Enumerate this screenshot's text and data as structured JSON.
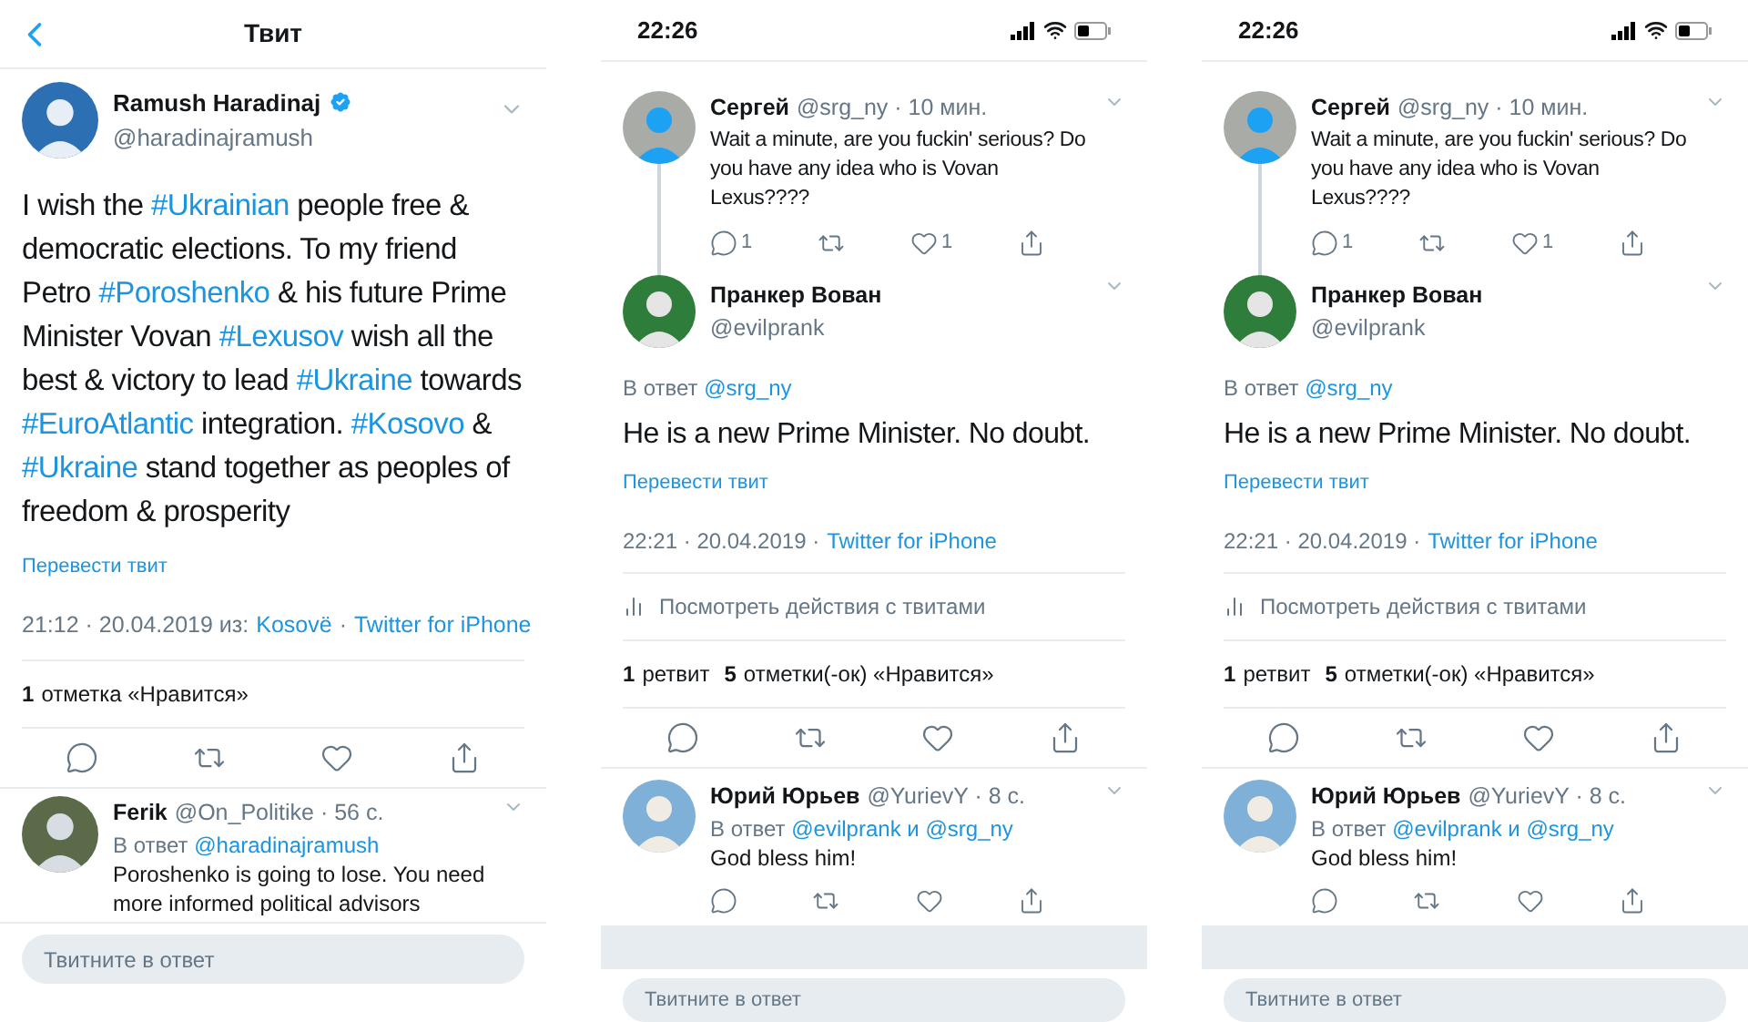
{
  "tweet_screen": {
    "header": {
      "title": "Твит"
    },
    "tweet": {
      "author": "Ramush Haradinaj",
      "verified": true,
      "handle": "@haradinajramush",
      "text": [
        {
          "kind": "plain",
          "text": "I wish the "
        },
        {
          "kind": "hashtag",
          "text": "#Ukrainian"
        },
        {
          "kind": "plain",
          "text": " people free & democratic elections. To my friend Petro "
        },
        {
          "kind": "hashtag",
          "text": "#Poroshenko"
        },
        {
          "kind": "plain",
          "text": " & his future Prime Minister Vovan "
        },
        {
          "kind": "hashtag",
          "text": "#Lexusov"
        },
        {
          "kind": "plain",
          "text": " wish all the best & victory to lead "
        },
        {
          "kind": "hashtag",
          "text": "#Ukraine"
        },
        {
          "kind": "plain",
          "text": " towards "
        },
        {
          "kind": "hashtag",
          "text": "#EuroAtlantic"
        },
        {
          "kind": "plain",
          "text": " integration. "
        },
        {
          "kind": "hashtag",
          "text": "#Kosovo"
        },
        {
          "kind": "plain",
          "text": " & "
        },
        {
          "kind": "hashtag",
          "text": "#Ukraine"
        },
        {
          "kind": "plain",
          "text": " stand together as peoples of freedom & prosperity"
        }
      ],
      "translate": "Перевести твит",
      "time": "21:12 · 20.04.2019 из:",
      "place": "Kosovë",
      "separator": "·",
      "source": "Twitter for iPhone",
      "stats": [
        {
          "count": "1",
          "label": "отметка «Нравится»"
        }
      ]
    },
    "reply": {
      "name": "Ferik",
      "handle": "@On_Politike · 56 с.",
      "reply_label": "В ответ",
      "mentions": [
        "@haradinajramush"
      ],
      "text": "Poroshenko is going to lose. You need more informed political advisors"
    },
    "compose": {
      "placeholder": "Твитните в ответ"
    }
  },
  "thread_screens": [
    {
      "status_time": "22:26",
      "parent": {
        "name": "Сергей",
        "handle": "@srg_ny · 10 мин.",
        "text": "Wait a minute, are you fuckin' serious? Do you have any idea who is Vovan Lexus????",
        "reply_count": "1",
        "like_count": "1"
      },
      "tweet": {
        "author": "Пранкер Вован",
        "handle": "@evilprank",
        "reply_label": "В ответ",
        "mentions": [
          "@srg_ny"
        ],
        "text": "He is a new Prime Minister. No doubt.",
        "translate": "Перевести твит",
        "time": "22:21 · 20.04.2019 ·",
        "source": "Twitter for iPhone",
        "activity": "Посмотреть действия с твитами",
        "stats": [
          {
            "count": "1",
            "label": "ретвит"
          },
          {
            "count": "5",
            "label": "отметки(-ок) «Нравится»"
          }
        ]
      },
      "reply": {
        "name": "Юрий Юрьев",
        "handle": "@YurievY · 8 с.",
        "reply_label": "В ответ",
        "mentions": [
          "@evilprank",
          "@srg_ny"
        ],
        "joiner": "и",
        "text": "God bless him!"
      },
      "compose": {
        "placeholder": "Твитните в ответ"
      }
    },
    {
      "status_time": "22:26",
      "parent": {
        "name": "Сергей",
        "handle": "@srg_ny · 10 мин.",
        "text": "Wait a minute, are you fuckin' serious? Do you have any idea who is Vovan Lexus????",
        "reply_count": "1",
        "like_count": "1"
      },
      "tweet": {
        "author": "Пранкер Вован",
        "handle": "@evilprank",
        "reply_label": "В ответ",
        "mentions": [
          "@srg_ny"
        ],
        "text": "He is a new Prime Minister. No doubt.",
        "translate": "Перевести твит",
        "time": "22:21 · 20.04.2019 ·",
        "source": "Twitter for iPhone",
        "activity": "Посмотреть действия с твитами",
        "stats": [
          {
            "count": "1",
            "label": "ретвит"
          },
          {
            "count": "5",
            "label": "отметки(-ок) «Нравится»"
          }
        ]
      },
      "reply": {
        "name": "Юрий Юрьев",
        "handle": "@YurievY · 8 с.",
        "reply_label": "В ответ",
        "mentions": [
          "@evilprank",
          "@srg_ny"
        ],
        "joiner": "и",
        "text": "God bless him!"
      },
      "compose": {
        "placeholder": "Твитните в ответ"
      }
    }
  ]
}
